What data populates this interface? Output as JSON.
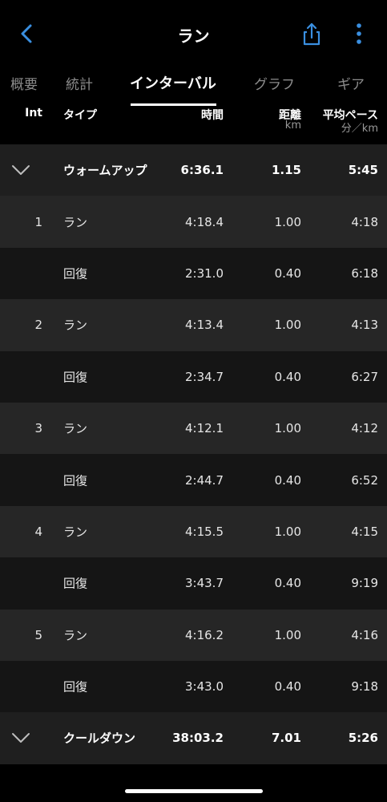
{
  "header": {
    "title": "ラン",
    "back_icon": "chevron-left-icon",
    "share_icon": "share-icon",
    "more_icon": "more-vertical-icon",
    "accent_color": "#3a8fe0"
  },
  "tabs": [
    {
      "label": "概要",
      "active": false
    },
    {
      "label": "統計",
      "active": false
    },
    {
      "label": "インターバル",
      "active": true
    },
    {
      "label": "グラフ",
      "active": false
    },
    {
      "label": "ギア",
      "active": false
    }
  ],
  "columns": {
    "int": "Int",
    "type": "タイプ",
    "time": "時間",
    "distance": "距離",
    "distance_unit": "km",
    "pace": "平均ペース",
    "pace_unit": "分／km"
  },
  "rows": [
    {
      "kind": "section",
      "num": "",
      "type": "ウォームアップ",
      "time": "6:36.1",
      "distance": "1.15",
      "pace": "5:45"
    },
    {
      "kind": "interval",
      "num": "1",
      "type": "ラン",
      "time": "4:18.4",
      "distance": "1.00",
      "pace": "4:18"
    },
    {
      "kind": "recovery",
      "num": "",
      "type": "回復",
      "time": "2:31.0",
      "distance": "0.40",
      "pace": "6:18"
    },
    {
      "kind": "interval",
      "num": "2",
      "type": "ラン",
      "time": "4:13.4",
      "distance": "1.00",
      "pace": "4:13"
    },
    {
      "kind": "recovery",
      "num": "",
      "type": "回復",
      "time": "2:34.7",
      "distance": "0.40",
      "pace": "6:27"
    },
    {
      "kind": "interval",
      "num": "3",
      "type": "ラン",
      "time": "4:12.1",
      "distance": "1.00",
      "pace": "4:12"
    },
    {
      "kind": "recovery",
      "num": "",
      "type": "回復",
      "time": "2:44.7",
      "distance": "0.40",
      "pace": "6:52"
    },
    {
      "kind": "interval",
      "num": "4",
      "type": "ラン",
      "time": "4:15.5",
      "distance": "1.00",
      "pace": "4:15"
    },
    {
      "kind": "recovery",
      "num": "",
      "type": "回復",
      "time": "3:43.7",
      "distance": "0.40",
      "pace": "9:19"
    },
    {
      "kind": "interval",
      "num": "5",
      "type": "ラン",
      "time": "4:16.2",
      "distance": "1.00",
      "pace": "4:16"
    },
    {
      "kind": "recovery",
      "num": "",
      "type": "回復",
      "time": "3:43.0",
      "distance": "0.40",
      "pace": "9:18"
    },
    {
      "kind": "section",
      "num": "",
      "type": "クールダウン",
      "time": "38:03.2",
      "distance": "7.01",
      "pace": "5:26"
    }
  ]
}
